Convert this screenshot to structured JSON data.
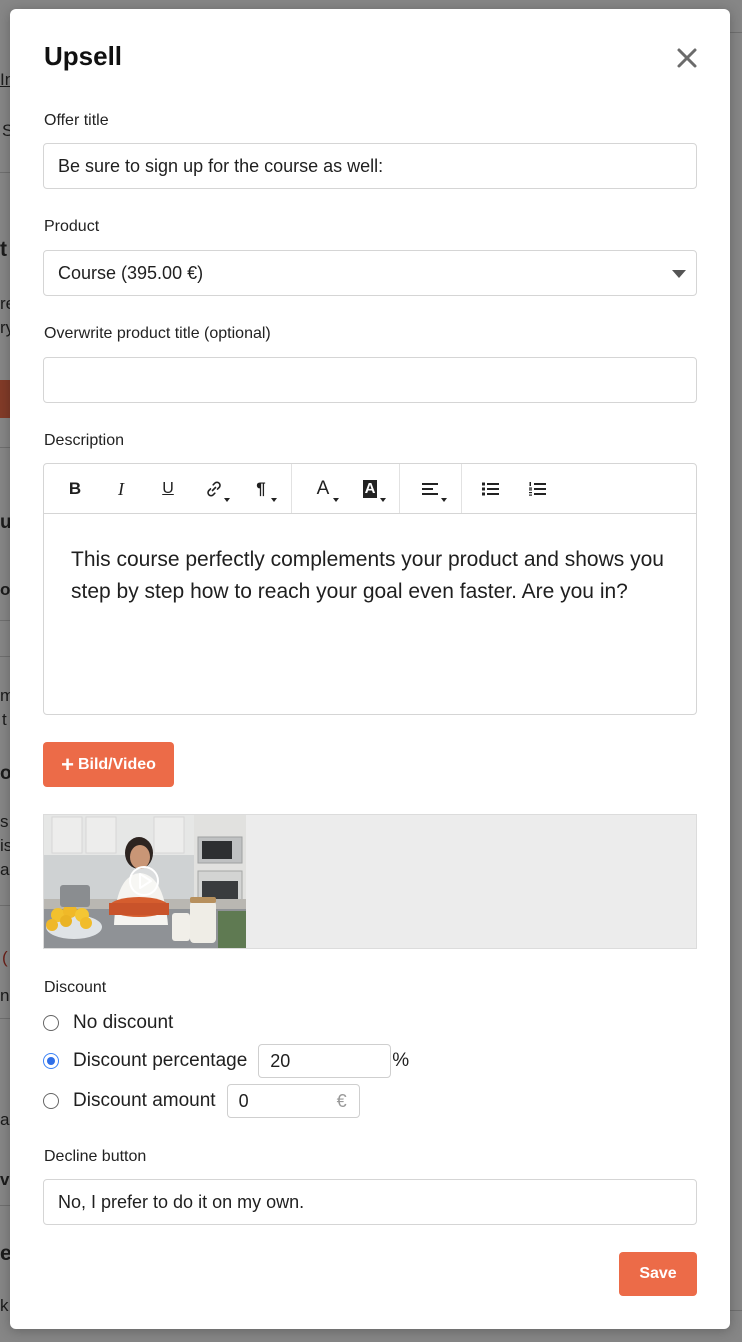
{
  "background": {
    "fragments_left": [
      "In",
      "S",
      "t",
      "re",
      "ry",
      "a",
      "u",
      "ou",
      "m",
      "t",
      "o",
      "s",
      "is",
      "a",
      "(",
      "n",
      "as",
      "v",
      "e",
      "k"
    ]
  },
  "modal": {
    "title": "Upsell",
    "close_icon": "close-icon"
  },
  "form": {
    "offer_title": {
      "label": "Offer title",
      "value": "Be sure to sign up for the course as well:"
    },
    "product": {
      "label": "Product",
      "selected": "Course (395.00 €)"
    },
    "overwrite_title": {
      "label": "Overwrite product title (optional)",
      "value": ""
    },
    "description": {
      "label": "Description",
      "text": "This course perfectly complements your product and shows you step by step how to reach your goal even faster. Are you in?"
    },
    "toolbar": {
      "bold": "B",
      "italic": "I",
      "underline": "U",
      "link_icon": "link-icon",
      "paragraph": "¶",
      "text_color": "A",
      "highlight": "A",
      "align_icon": "align-left-icon",
      "bullet_list_icon": "bullet-list-icon",
      "numbered_list_icon": "numbered-list-icon"
    },
    "add_media": {
      "plus": "+",
      "label": "Bild/Video"
    },
    "media": {
      "type": "video",
      "play_icon": "play-icon"
    },
    "discount": {
      "label": "Discount",
      "options": [
        {
          "label": "No discount",
          "checked": false
        },
        {
          "label": "Discount percentage",
          "checked": true,
          "value": "20",
          "suffix": "%"
        },
        {
          "label": "Discount amount",
          "checked": false,
          "value": "0",
          "suffix": "€"
        }
      ]
    },
    "decline_button": {
      "label": "Decline button",
      "value": "No, I prefer to do it on my own."
    },
    "save": "Save"
  },
  "colors": {
    "accent": "#ec6b48",
    "radio_checked": "#2f6fe8",
    "border": "#d5d5d5"
  }
}
